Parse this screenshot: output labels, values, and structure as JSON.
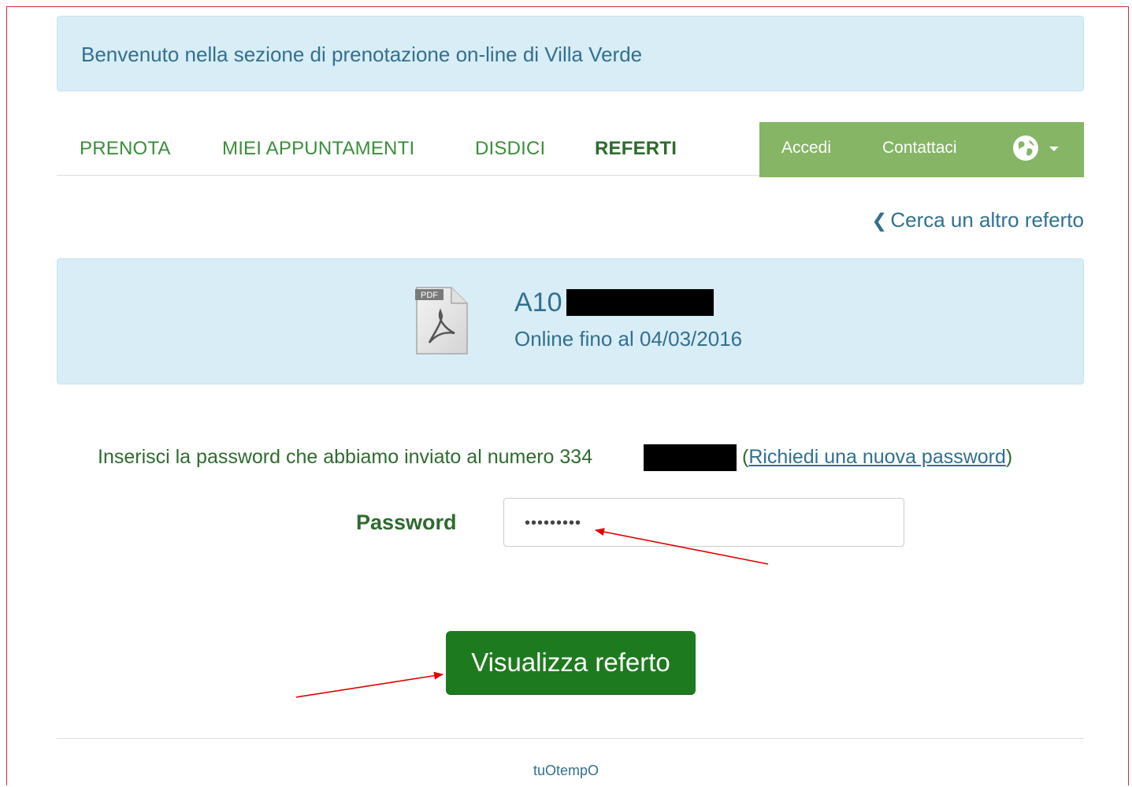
{
  "header": {
    "welcome_text": "Benvenuto nella sezione di prenotazione on-line di Villa Verde"
  },
  "nav": {
    "items": [
      {
        "label": "PRENOTA"
      },
      {
        "label": "MIEI APPUNTAMENTI"
      },
      {
        "label": "DISDICI"
      },
      {
        "label": "REFERTI",
        "active": true
      }
    ],
    "login_label": "Accedi",
    "contact_label": "Contattaci",
    "language_icon": "globe-icon"
  },
  "back_link": {
    "label": "Cerca un altro referto",
    "icon": "chevron-left-icon"
  },
  "document": {
    "icon": "pdf-file-icon",
    "icon_text": "PDF",
    "code_visible": "A10",
    "code_redacted": true,
    "valid_until": "Online fino al 04/03/2016"
  },
  "password_section": {
    "instruction_prefix": "Inserisci la password che abbiamo inviato al numero 334",
    "phone_redacted": true,
    "open_paren": "(",
    "new_password_link": "Richiedi una nuova password",
    "close_paren": ")",
    "label": "Password",
    "value": "•••••••••"
  },
  "submit": {
    "label": "Visualizza referto"
  },
  "footer": {
    "brand": "tuOtempO"
  },
  "colors": {
    "info_bg": "#d9edf7",
    "info_text": "#31708f",
    "nav_green": "#85b565",
    "button_green": "#1e7a1e",
    "annotation_red": "#e00000"
  }
}
